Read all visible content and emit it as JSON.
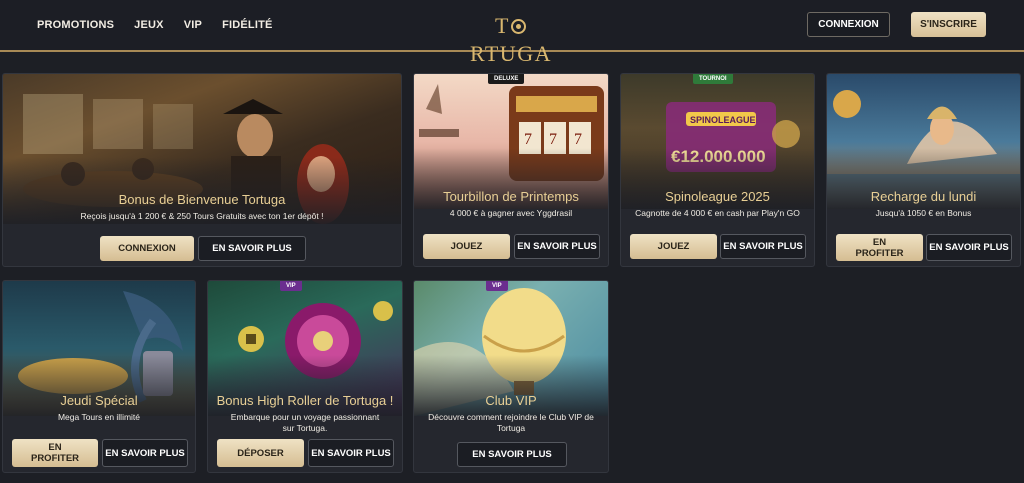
{
  "header": {
    "nav": [
      "PROMOTIONS",
      "JEUX",
      "VIP",
      "FIDÉLITÉ"
    ],
    "logo_left": "T",
    "logo_right": "RTUGA",
    "login_label": "CONNEXION",
    "signup_label": "S'INSCRIRE"
  },
  "cards": [
    {
      "title": "Bonus de Bienvenue Tortuga",
      "subtitle": "Reçois jusqu'à 1 200 € & 250 Tours Gratuits avec ton 1er dépôt !",
      "primary": "CONNEXION",
      "secondary": "EN SAVOIR PLUS"
    },
    {
      "tag": "DELUXE",
      "title": "Tourbillon de Printemps",
      "subtitle": "4 000 € à gagner avec Yggdrasil",
      "primary": "JOUEZ",
      "secondary": "EN SAVOIR PLUS"
    },
    {
      "tag": "TOURNOI",
      "title": "Spinoleague 2025",
      "subtitle": "Cagnotte de 4 000 € en cash par Play'n GO",
      "primary": "JOUEZ",
      "secondary": "EN SAVOIR PLUS",
      "art_text": "SPINOLEAGUE",
      "art_amount": "€12.000.000"
    },
    {
      "title": "Recharge du lundi",
      "subtitle": "Jusqu'à 1050 € en Bonus",
      "primary": "EN PROFITER",
      "secondary": "EN SAVOIR PLUS"
    },
    {
      "title": "Jeudi Spécial",
      "subtitle": "Mega Tours en illimité",
      "primary": "EN PROFITER",
      "secondary": "EN SAVOIR PLUS"
    },
    {
      "tag": "VIP",
      "title": "Bonus High Roller de Tortuga !",
      "subtitle": "Embarque pour un voyage passionnant sur Tortuga.",
      "primary": "DÉPOSER",
      "secondary": "EN SAVOIR PLUS"
    },
    {
      "tag": "VIP",
      "title": "Club VIP",
      "subtitle": "Découvre comment rejoindre le Club VIP de Tortuga",
      "secondary": "EN SAVOIR PLUS"
    }
  ],
  "colors": {
    "accent_gold": "#d9b76f",
    "title_gold": "#e8cf95",
    "background": "#1d1f25"
  }
}
